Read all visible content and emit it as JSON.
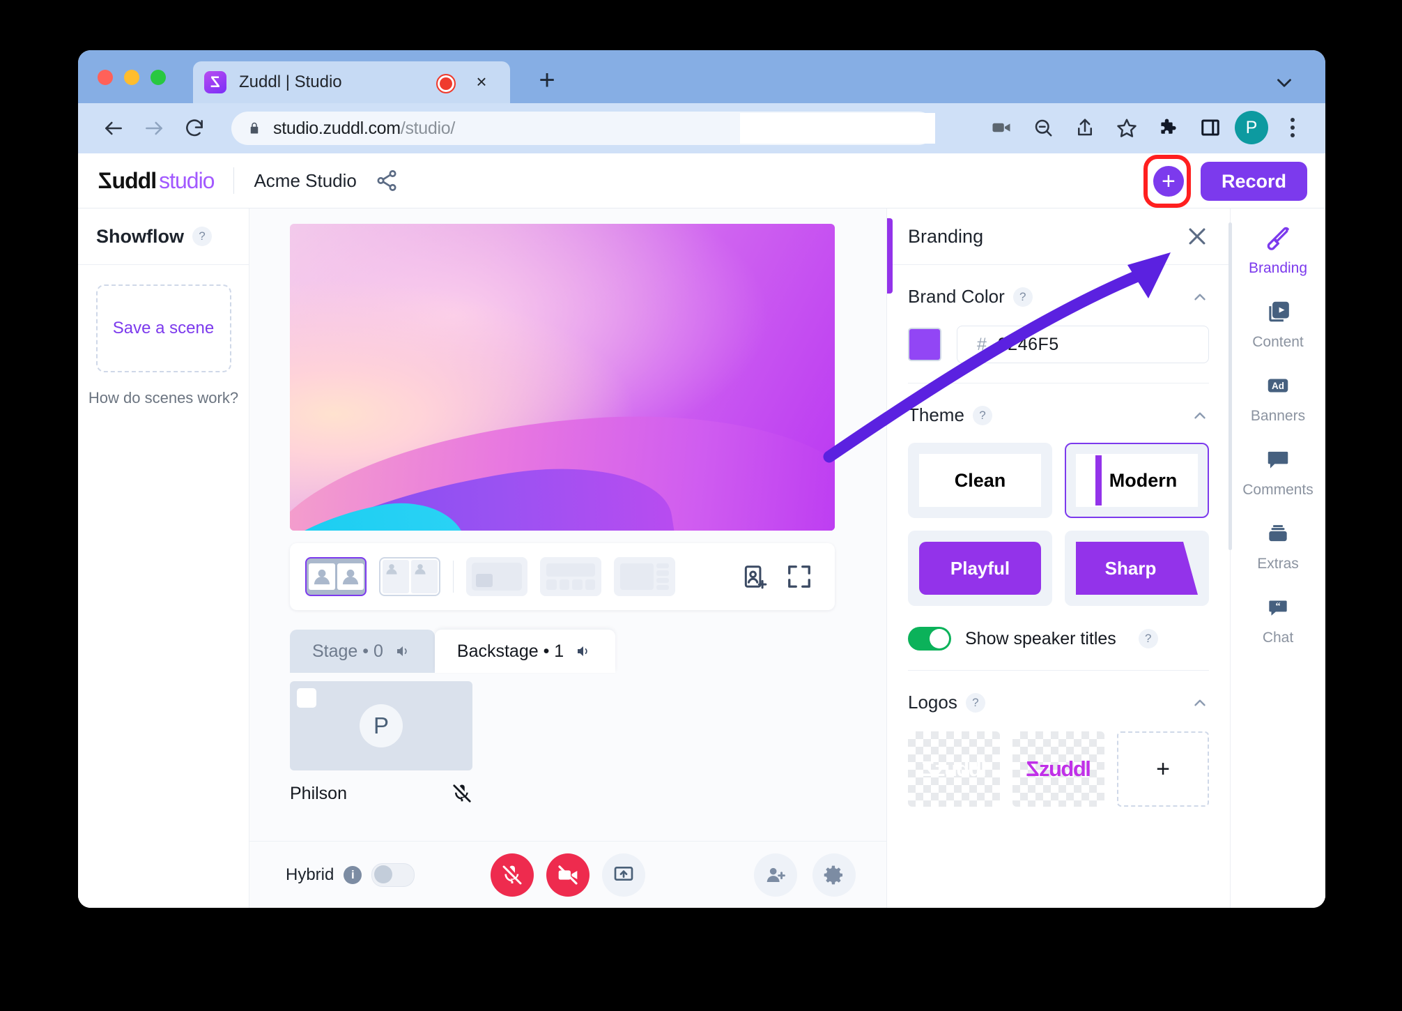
{
  "browser": {
    "tab": {
      "title": "Zuddl | Studio",
      "favicon": "zuddl-favicon",
      "recording_indicator": "record-dot",
      "close": "×"
    },
    "new_tab_label": "+",
    "url": {
      "secure": true,
      "text_visible": "studio.zuddl.com/studio/",
      "host": "studio.zuddl.com",
      "path_dim": "/studio/"
    },
    "toolbar_icons": [
      "video-camera-icon",
      "zoom-out-icon",
      "share-icon",
      "bookmark-star-icon",
      "extensions-puzzle-icon",
      "side-panel-icon"
    ],
    "profile_initial": "P",
    "menu_icon": "kebab-menu-icon"
  },
  "app": {
    "logo": {
      "brand": "zuddl",
      "product": "studio"
    },
    "studio_name": "Acme Studio",
    "share_icon": "share-nodes-icon",
    "add_button_label": "+",
    "record_button_label": "Record"
  },
  "sidebar": {
    "title": "Showflow",
    "help": "?",
    "save_scene_label": "Save a scene",
    "how_scenes_label": "How do scenes work?"
  },
  "stage": {
    "layouts": [
      {
        "name": "two-up-layout",
        "selected": true
      },
      {
        "name": "split-layout",
        "selected": false
      },
      {
        "name": "screenshare-pip-layout",
        "selected": false
      },
      {
        "name": "presenter-strip-layout",
        "selected": false
      },
      {
        "name": "sidebar-grid-layout",
        "selected": false
      }
    ],
    "layout_actions": [
      "add-participant-to-stage-icon",
      "fullscreen-icon"
    ],
    "tabs": [
      {
        "label": "Stage • 0",
        "name": "Stage",
        "count": 0,
        "active": false,
        "speaker_icon": "speaker-icon"
      },
      {
        "label": "Backstage • 1",
        "name": "Backstage",
        "count": 1,
        "active": true,
        "speaker_icon": "speaker-icon"
      }
    ],
    "participant": {
      "initial": "P",
      "name": "Philson",
      "mic": "mic-muted-icon"
    }
  },
  "controls": {
    "hybrid_label": "Hybrid",
    "hybrid_info": "i",
    "hybrid_on": false,
    "buttons": [
      {
        "name": "mic-muted-button",
        "state": "muted",
        "color": "#ee2b4e"
      },
      {
        "name": "camera-off-button",
        "state": "off",
        "color": "#ee2b4e"
      },
      {
        "name": "share-screen-button",
        "state": "idle",
        "color": "#eef2f8"
      }
    ],
    "right_buttons": [
      {
        "name": "invite-participant-button"
      },
      {
        "name": "settings-gear-button"
      }
    ]
  },
  "panel": {
    "title": "Branding",
    "close_label": "×",
    "brand_color": {
      "title": "Brand Color",
      "help": "?",
      "hash": "#",
      "hex": "9246F5",
      "swatch_color": "#9246F5"
    },
    "theme": {
      "title": "Theme",
      "help": "?",
      "options": [
        {
          "label": "Clean",
          "selected": false
        },
        {
          "label": "Modern",
          "selected": true
        },
        {
          "label": "Playful",
          "selected": false
        },
        {
          "label": "Sharp",
          "selected": false
        }
      ]
    },
    "speaker_titles": {
      "label": "Show speaker titles",
      "help": "?",
      "enabled": true
    },
    "logos": {
      "title": "Logos",
      "help": "?",
      "items": [
        {
          "name": "logo-white-zuddl",
          "text": "zuddl",
          "variant": "white"
        },
        {
          "name": "logo-purple-zuddl",
          "text": "zuddl",
          "variant": "purple"
        }
      ],
      "add_label": "+"
    }
  },
  "rail": {
    "items": [
      {
        "label": "Branding",
        "icon": "brush-icon",
        "active": true
      },
      {
        "label": "Content",
        "icon": "media-play-icon",
        "active": false
      },
      {
        "label": "Banners",
        "icon": "ad-icon",
        "active": false
      },
      {
        "label": "Comments",
        "icon": "comment-icon",
        "active": false
      },
      {
        "label": "Extras",
        "icon": "layers-icon",
        "active": false
      },
      {
        "label": "Chat",
        "icon": "quote-chat-icon",
        "active": false
      }
    ]
  },
  "annotation": {
    "arrow_color": "#5b21e0",
    "highlight_color": "#ff1f1f",
    "highlight_target": "add-button"
  }
}
